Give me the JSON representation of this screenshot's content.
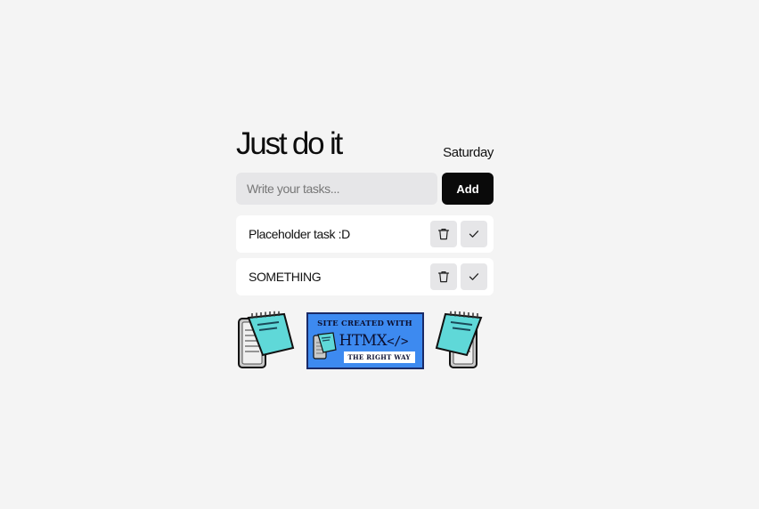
{
  "app": {
    "title": "Just do it",
    "day": "Saturday"
  },
  "form": {
    "placeholder": "Write your tasks...",
    "value": "",
    "add_label": "Add"
  },
  "tasks": [
    {
      "text": "Placeholder task :D"
    },
    {
      "text": "SOMETHING"
    }
  ],
  "badge": {
    "line1": "SITE CREATED WITH",
    "line2": "HTMX",
    "line2_tag": "</>",
    "line3": "THE RIGHT WAY"
  },
  "icons": {
    "delete": "trash-icon",
    "complete": "checkmark-icon",
    "decoration": "notepad-icon"
  },
  "colors": {
    "background": "#f4f4f4",
    "add_button": "#0a0a0a",
    "input_bg": "#e6e6e8",
    "badge_bg": "#3d8af0",
    "notepad_cover": "#5fd8d8"
  }
}
